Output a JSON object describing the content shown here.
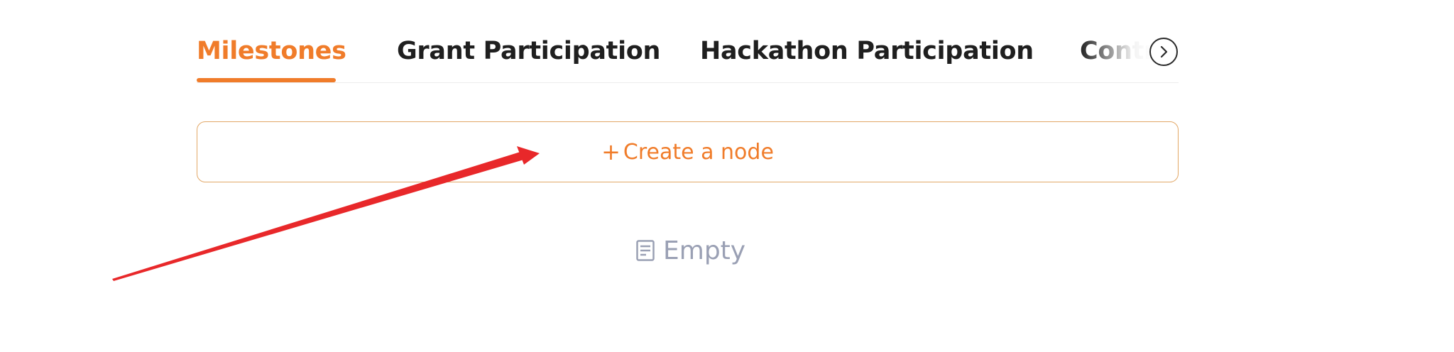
{
  "tabs": [
    {
      "label": "Milestones",
      "active": true
    },
    {
      "label": "Grant Participation",
      "active": false
    },
    {
      "label": "Hackathon Participation",
      "active": false
    },
    {
      "label": "Contributions",
      "active": false
    }
  ],
  "tab_next_icon": "chevron-right-icon",
  "create_node": {
    "plus": "+",
    "label": "Create a node"
  },
  "empty_state": {
    "icon": "document-icon",
    "label": "Empty"
  },
  "colors": {
    "accent": "#f07c2a",
    "tab_text": "#1f1f1f",
    "create_border": "#e2a766",
    "empty_text": "#9aa0b4",
    "annotation_arrow": "#e8282a"
  }
}
